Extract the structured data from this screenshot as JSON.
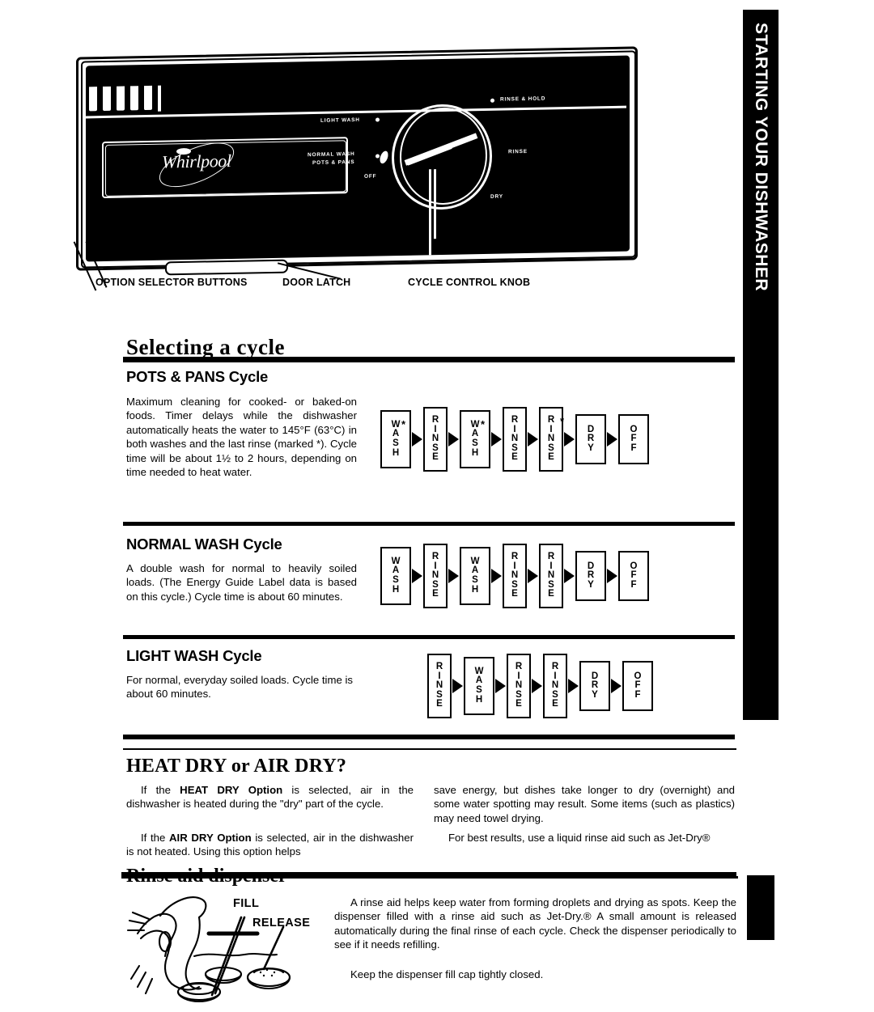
{
  "thumb_tab": {
    "label": "STARTING YOUR DISHWASHER"
  },
  "appliance": {
    "brand": "Whirlpool",
    "dial_labels": {
      "light_wash": "LIGHT WASH",
      "normal_wash": "NORMAL WASH",
      "pots_pans": "POTS & PANS",
      "off": "OFF",
      "rinse_hold": "RINSE & HOLD",
      "rinse": "RINSE",
      "dry": "DRY"
    },
    "captions": [
      "OPTION SELECTOR BUTTONS",
      "DOOR LATCH",
      "CYCLE CONTROL KNOB"
    ]
  },
  "page_title": "Selecting a cycle",
  "sections": [
    {
      "heading": "POTS & PANS Cycle",
      "body": "Maximum cleaning for cooked- or baked-on foods. Timer delays while the dishwasher automatically heats the water to 145°F (63°C) in both washes and the last rinse (marked *). Cycle time will be about 1½ to 2 hours, depending on time needed to heat water.",
      "flow": [
        {
          "label": "W\nA\nS\nH",
          "star": true
        },
        {
          "label": "R\nI\nN\nS\nE",
          "star": false
        },
        {
          "label": "W\nA\nS\nH",
          "star": true
        },
        {
          "label": "R\nI\nN\nS\nE",
          "star": false
        },
        {
          "label": "R\nI\nN\nS\nE",
          "star": true
        },
        {
          "label": "D\nR\nY",
          "star": false
        },
        {
          "label": "O\nF\nF",
          "star": false
        }
      ]
    },
    {
      "heading": "NORMAL WASH Cycle",
      "body": "A double wash for normal to heavily soiled loads. (The Energy Guide Label data is based on this cycle.) Cycle time is about 60 minutes.",
      "flow": [
        {
          "label": "W\nA\nS\nH",
          "star": false
        },
        {
          "label": "R\nI\nN\nS\nE",
          "star": false
        },
        {
          "label": "W\nA\nS\nH",
          "star": false
        },
        {
          "label": "R\nI\nN\nS\nE",
          "star": false
        },
        {
          "label": "R\nI\nN\nS\nE",
          "star": false
        },
        {
          "label": "D\nR\nY",
          "star": false
        },
        {
          "label": "O\nF\nF",
          "star": false
        }
      ]
    },
    {
      "heading": "LIGHT WASH Cycle",
      "body": "For normal, everyday soiled loads. Cycle time is about 60 minutes.",
      "flow": [
        {
          "label": "R\nI\nN\nS\nE",
          "star": false
        },
        {
          "label": "W\nA\nS\nH",
          "star": false
        },
        {
          "label": "R\nI\nN\nS\nE",
          "star": false
        },
        {
          "label": "R\nI\nN\nS\nE",
          "star": false
        },
        {
          "label": "D\nR\nY",
          "star": false
        },
        {
          "label": "O\nF\nF",
          "star": false
        }
      ]
    }
  ],
  "heat_dry": {
    "heading": "HEAT DRY or AIR DRY?",
    "left_p1_lead": "If the ",
    "left_p1_bold": "HEAT DRY Option",
    "left_p1_rest": " is selected, air in the dishwasher is heated during the \"dry\" part of the cycle.",
    "left_p2_lead": "If the ",
    "left_p2_bold": "AIR DRY Option",
    "left_p2_rest": " is selected, air in the dishwasher is not heated. Using this option helps",
    "right_p1": "save energy, but dishes take longer to dry (overnight) and some water spotting may result. Some items (such as plastics) may need towel drying.",
    "right_p2": "For best results, use a liquid rinse aid such as Jet-Dry®"
  },
  "rinse_aid": {
    "heading": "Rinse aid dispenser",
    "illustration_labels": {
      "fill": "FILL",
      "release": "RELEASE"
    },
    "p1": "A rinse aid helps keep water from forming droplets and drying as spots. Keep the dispenser filled with a rinse aid such as Jet-Dry.® A small amount is released automatically during the final rinse of each cycle. Check the dispenser periodically to see if it needs refilling.",
    "p2": "Keep the dispenser fill cap tightly closed."
  }
}
